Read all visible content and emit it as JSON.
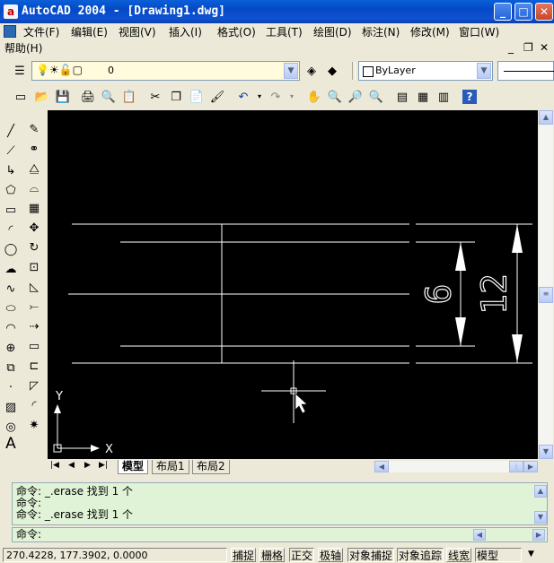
{
  "window": {
    "title": "AutoCAD 2004 - [Drawing1.dwg]"
  },
  "menu": {
    "items": [
      {
        "label": "文件(F)"
      },
      {
        "label": "编辑(E)"
      },
      {
        "label": "视图(V)"
      },
      {
        "label": "插入(I)"
      },
      {
        "label": "格式(O)"
      },
      {
        "label": "工具(T)"
      },
      {
        "label": "绘图(D)"
      },
      {
        "label": "标注(N)"
      },
      {
        "label": "修改(M)"
      },
      {
        "label": "窗口(W)"
      },
      {
        "label": "帮助(H)"
      }
    ]
  },
  "layers": {
    "current_layer": "0",
    "color": "ByLayer"
  },
  "drawing": {
    "dimension_inner": "6",
    "dimension_outer": "12",
    "ucs_x": "X",
    "ucs_y": "Y",
    "background": "#000000",
    "line_color": "#ffffff"
  },
  "tabs": [
    "模型",
    "布局1",
    "布局2"
  ],
  "command": {
    "history": [
      "命令: _.erase 找到 1 个",
      "命令:",
      "命令: _.erase 找到 1 个"
    ],
    "prompt": "命令:"
  },
  "status": {
    "coordinates": "270.4228, 177.3902, 0.0000",
    "toggles": [
      "捕捉",
      "栅格",
      "正交",
      "极轴",
      "对象捕捉",
      "对象追踪",
      "线宽",
      "模型"
    ]
  },
  "colors": {
    "titlebar": "#0a5fd8",
    "command_bg": "#e0f3d6",
    "canvas": "#000000"
  }
}
